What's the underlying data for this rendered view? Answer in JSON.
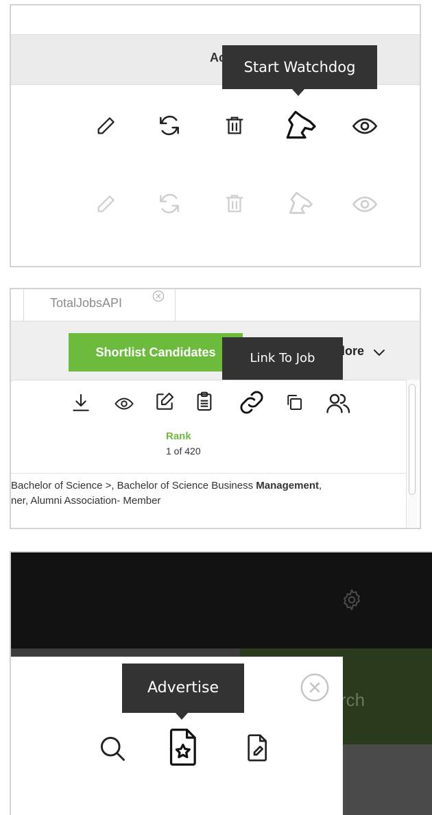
{
  "panel1": {
    "header_partial": "Ac",
    "tooltip": "Start Watchdog",
    "row_icons": [
      "pencil-icon",
      "refresh-icon",
      "trash-icon",
      "dog-icon",
      "eye-icon"
    ]
  },
  "panel2": {
    "tab_label": "TotalJobsAPI",
    "shortlist_button": "Shortlist Candidates",
    "more_label": "lore",
    "tooltip": "Link To Job",
    "rank_label": "Rank",
    "rank_value": "1 of 420",
    "snippet_line1_plain": "Bachelor of Science >, Bachelor of Science Business ",
    "snippet_line1_bold": "Management",
    "snippet_line1_end": ",",
    "snippet_line2": "ner, Alumni Association- Member",
    "accent_color": "#6dbb3c"
  },
  "panel3": {
    "tooltip": "Advertise",
    "search_partial": "rch",
    "accent_color": "#2a3a1c"
  }
}
